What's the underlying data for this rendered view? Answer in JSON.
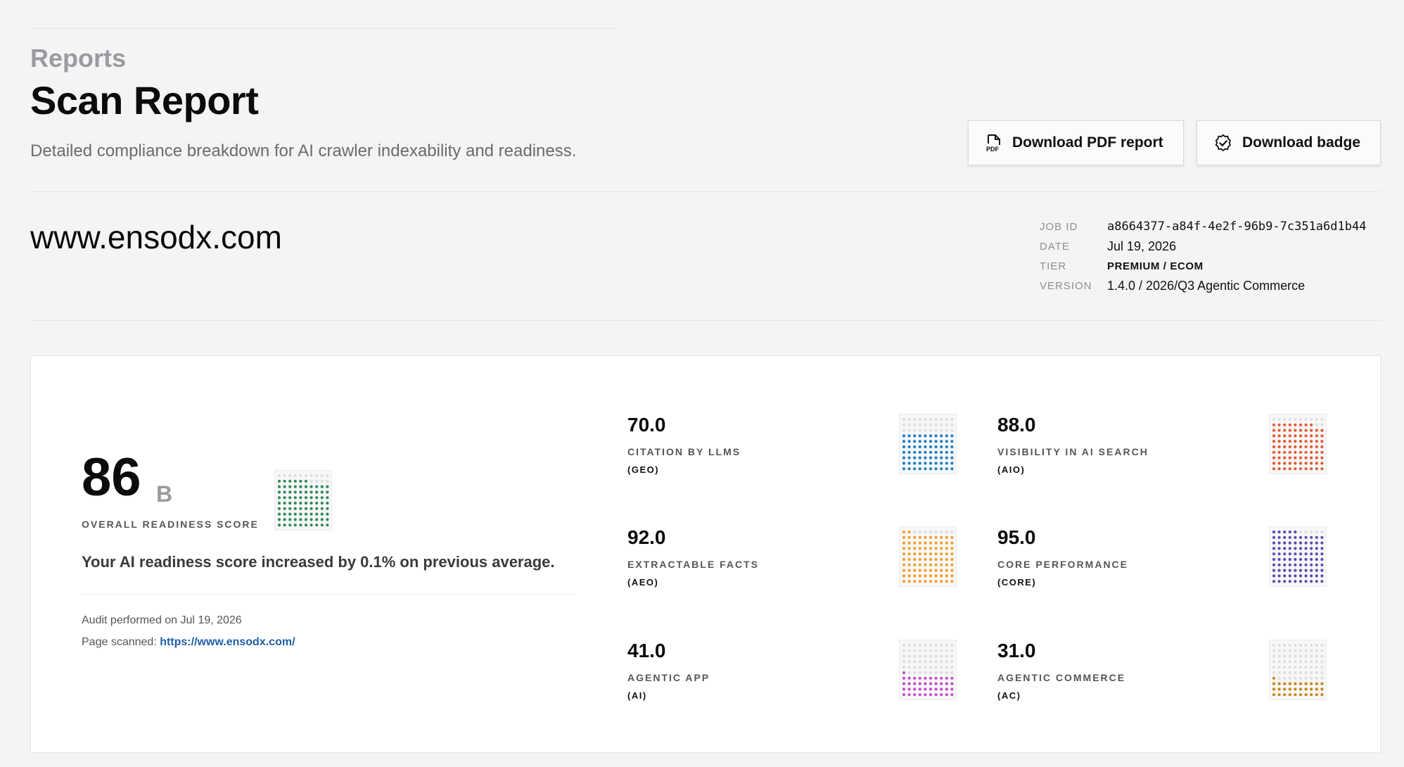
{
  "header": {
    "breadcrumb": "Reports",
    "title": "Scan Report",
    "subtitle": "Detailed compliance breakdown for AI crawler indexability and readiness."
  },
  "actions": {
    "pdf_label": "Download PDF report",
    "badge_label": "Download badge"
  },
  "site": {
    "domain": "www.ensodx.com"
  },
  "meta": {
    "job_id_label": "JOB ID",
    "job_id": "a8664377-a84f-4e2f-96b9-7c351a6d1b44",
    "date_label": "DATE",
    "date": "Jul 19, 2026",
    "tier_label": "TIER",
    "tier": "PREMIUM / ECOM",
    "version_label": "VERSION",
    "version": "1.4.0 / 2026/Q3 Agentic Commerce"
  },
  "overall": {
    "score": "86",
    "grade": "B",
    "label": "OVERALL READINESS SCORE",
    "fill": 0.86,
    "color": "#2e8b57",
    "message": "Your AI readiness score increased by 0.1% on previous average.",
    "audit": "Audit performed on Jul 19, 2026",
    "scanned_label": "Page scanned: ",
    "scanned_url": "https://www.ensodx.com/"
  },
  "metrics": [
    {
      "value": "70.0",
      "label": "CITATION BY LLMS",
      "code": "(GEO)",
      "fill": 0.7,
      "color": "#1f7fc0"
    },
    {
      "value": "88.0",
      "label": "VISIBILITY IN AI SEARCH",
      "code": "(AIO)",
      "fill": 0.88,
      "color": "#e35a2f"
    },
    {
      "value": "92.0",
      "label": "EXTRACTABLE FACTS",
      "code": "(AEO)",
      "fill": 0.92,
      "color": "#f0a12a"
    },
    {
      "value": "95.0",
      "label": "CORE PERFORMANCE",
      "code": "(CORE)",
      "fill": 0.95,
      "color": "#5b4cb3"
    },
    {
      "value": "41.0",
      "label": "AGENTIC APP",
      "code": "(AI)",
      "fill": 0.41,
      "color": "#c24dc9"
    },
    {
      "value": "31.0",
      "label": "AGENTIC COMMERCE",
      "code": "(AC)",
      "fill": 0.31,
      "color": "#c98417"
    }
  ]
}
